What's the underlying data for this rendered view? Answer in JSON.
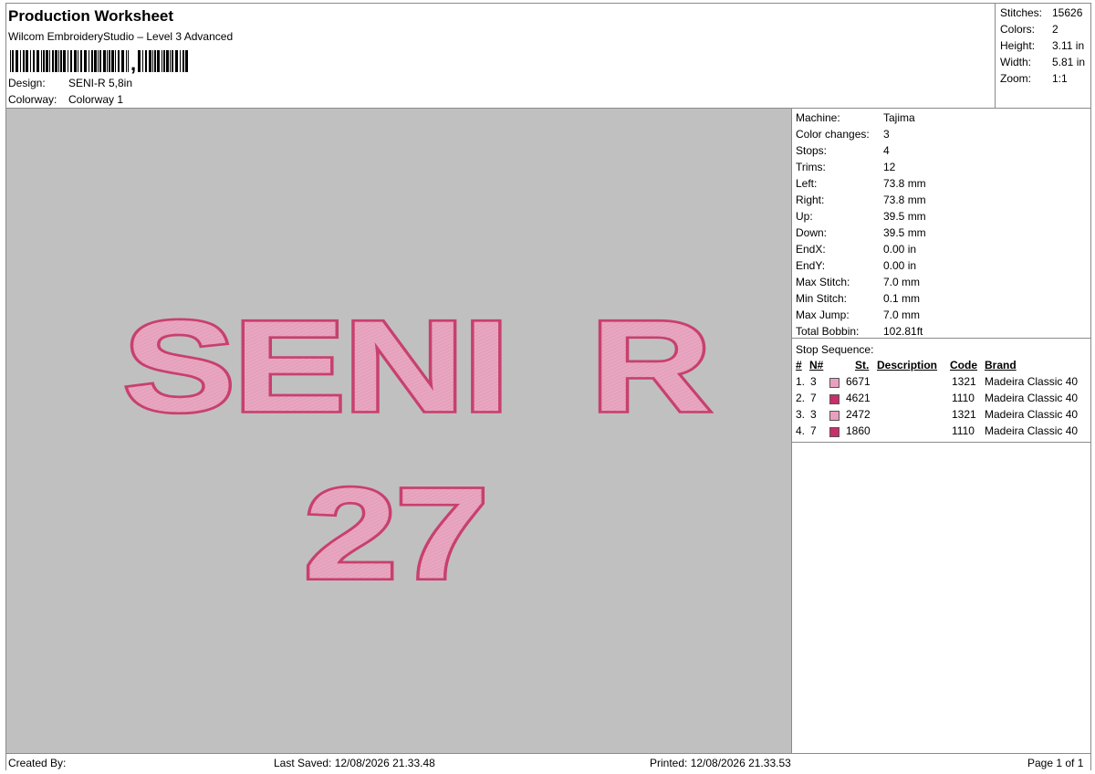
{
  "header": {
    "title": "Production Worksheet",
    "subtitle": "Wilcom EmbroideryStudio – Level 3 Advanced",
    "design_label": "Design:",
    "design_value": "SENI-R 5,8in",
    "colorway_label": "Colorway:",
    "colorway_value": "Colorway 1"
  },
  "stats": {
    "stitches_label": "Stitches:",
    "stitches_value": "15626",
    "colors_label": "Colors:",
    "colors_value": "2",
    "height_label": "Height:",
    "height_value": "3.11 in",
    "width_label": "Width:",
    "width_value": "5.81 in",
    "zoom_label": "Zoom:",
    "zoom_value": "1:1"
  },
  "design_preview": {
    "line1": "SENI R",
    "line2": "27",
    "fill_color": "#e8a6c0",
    "outline_color": "#c8406e",
    "background": "#c0c0c0"
  },
  "machine_info": [
    {
      "label": "Machine:",
      "value": "Tajima"
    },
    {
      "label": "Color changes:",
      "value": "3"
    },
    {
      "label": "Stops:",
      "value": "4"
    },
    {
      "label": "Trims:",
      "value": "12"
    },
    {
      "label": "Left:",
      "value": "73.8 mm"
    },
    {
      "label": "Right:",
      "value": "73.8 mm"
    },
    {
      "label": "Up:",
      "value": "39.5 mm"
    },
    {
      "label": "Down:",
      "value": "39.5 mm"
    },
    {
      "label": "EndX:",
      "value": "0.00 in"
    },
    {
      "label": "EndY:",
      "value": "0.00 in"
    },
    {
      "label": "Max Stitch:",
      "value": "7.0 mm"
    },
    {
      "label": "Min Stitch:",
      "value": "0.1 mm"
    },
    {
      "label": "Max Jump:",
      "value": "7.0 mm"
    },
    {
      "label": "Total Bobbin:",
      "value": "102.81ft"
    }
  ],
  "stop_sequence": {
    "title": "Stop Sequence:",
    "headers": {
      "num": "#",
      "n": "N#",
      "st": "St.",
      "description": "Description",
      "code": "Code",
      "brand": "Brand"
    },
    "rows": [
      {
        "num": "1.",
        "n": "3",
        "st": "6671",
        "code": "1321",
        "brand": "Madeira Classic 40",
        "color": "#e8a0c0"
      },
      {
        "num": "2.",
        "n": "7",
        "st": "4621",
        "code": "1110",
        "brand": "Madeira Classic 40",
        "color": "#c8306a"
      },
      {
        "num": "3.",
        "n": "3",
        "st": "2472",
        "code": "1321",
        "brand": "Madeira Classic 40",
        "color": "#e8a0c0"
      },
      {
        "num": "4.",
        "n": "7",
        "st": "1860",
        "code": "1110",
        "brand": "Madeira Classic 40",
        "color": "#c8306a"
      }
    ]
  },
  "footer": {
    "created_by": "Created By:",
    "last_saved": "Last Saved: 12/08/2026 21.33.48",
    "printed": "Printed: 12/08/2026 21.33.53",
    "page": "Page 1 of 1"
  }
}
